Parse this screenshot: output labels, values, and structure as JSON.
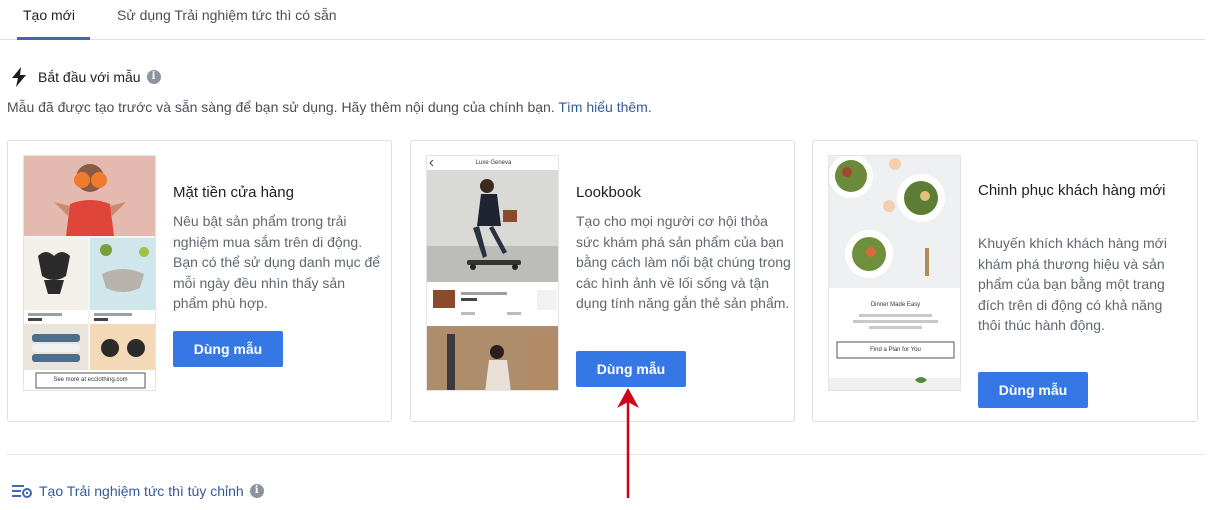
{
  "tabs": [
    {
      "label": "Tạo mới",
      "active": true
    },
    {
      "label": "Sử dụng Trải nghiệm tức thì có sẵn",
      "active": false
    }
  ],
  "section": {
    "title": "Bắt đầu với mẫu",
    "description": "Mẫu đã được tạo trước và sẵn sàng để bạn sử dụng. Hãy thêm nội dung của chính bạn.",
    "learn_more": "Tìm hiểu thêm."
  },
  "templates": [
    {
      "title": "Mặt tiền cửa hàng",
      "text": "Nêu bật sản phẩm trong trải nghiệm mua sắm trên di động. Bạn có thể sử dụng danh mục để mỗi ngày đều nhìn thấy sản phẩm phù hợp.",
      "button": "Dùng mẫu",
      "thumb_caption": "See more at ecclothing.com"
    },
    {
      "title": "Lookbook",
      "text": "Tạo cho mọi người cơ hội thỏa sức khám phá sản phẩm của bạn bằng cách làm nổi bật chúng trong các hình ảnh về lối sống và tận dụng tính năng gắn thẻ sản phẩm.",
      "button": "Dùng mẫu",
      "thumb_header": "Luxe Geneva"
    },
    {
      "title": "Chinh phục khách hàng mới",
      "text": "Khuyến khích khách hàng mới khám phá thương hiệu và sản phẩm của bạn bằng một trang đích trên di động có khả năng thôi thúc hành động.",
      "button": "Dùng mẫu",
      "thumb_heading": "Dinner Made Easy",
      "thumb_button": "Find a Plan for You"
    }
  ],
  "custom": {
    "label": "Tạo Trải nghiệm tức thì tùy chỉnh"
  },
  "colors": {
    "accent": "#4267b2",
    "button": "#3578e5",
    "link": "#365899",
    "arrow": "#d0021b"
  },
  "icons": {
    "bolt": "lightning-bolt-icon",
    "info": "info-circle-icon",
    "custom": "list-settings-icon"
  }
}
